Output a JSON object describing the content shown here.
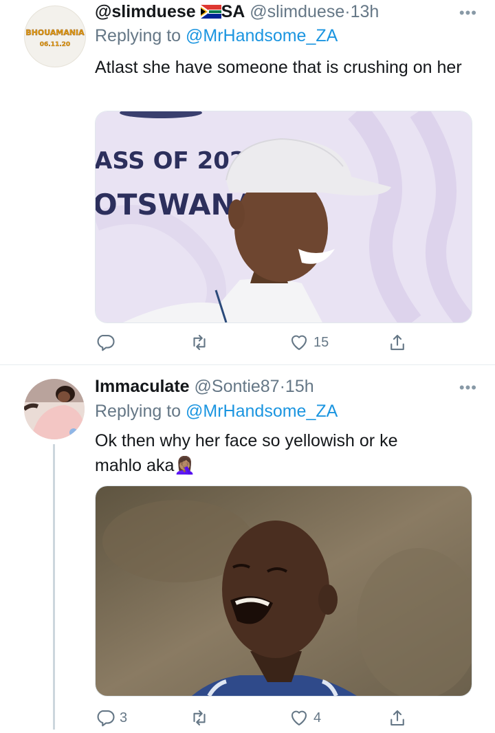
{
  "tweets": [
    {
      "display_name": "@slimduese",
      "country": "SA",
      "handle": "@slimduese",
      "dot": "·",
      "time": "13h",
      "replying_prefix": "Replying to",
      "replying_to": "@MrHandsome_ZA",
      "text": "Atlast she have someone that is crushing on her",
      "avatar_logo_line1": "BHOUAMANIA",
      "avatar_logo_line2": "06.11.20",
      "media_sign_line1": "ASS OF 202",
      "media_sign_line2": "OTSWANA",
      "replies": "",
      "likes": "15",
      "more": "•••"
    },
    {
      "display_name": "Immaculate",
      "handle": "@Sontie87",
      "dot": "·",
      "time": "15h",
      "replying_prefix": "Replying to",
      "replying_to": "@MrHandsome_ZA",
      "text": "Ok then why her face so yellowish or ke mahlo aka",
      "emoji": "🤦🏽‍♀️",
      "replies": "3",
      "likes": "4",
      "more": "•••"
    }
  ],
  "colors": {
    "link": "#1b95e0",
    "secondary": "#657786",
    "divider": "#e6ecf0",
    "thread_line": "#ccd6dd"
  },
  "icons": [
    "reply-icon",
    "retweet-icon",
    "like-icon",
    "share-icon",
    "more-icon",
    "south-africa-flag-icon",
    "facepalm-emoji"
  ]
}
